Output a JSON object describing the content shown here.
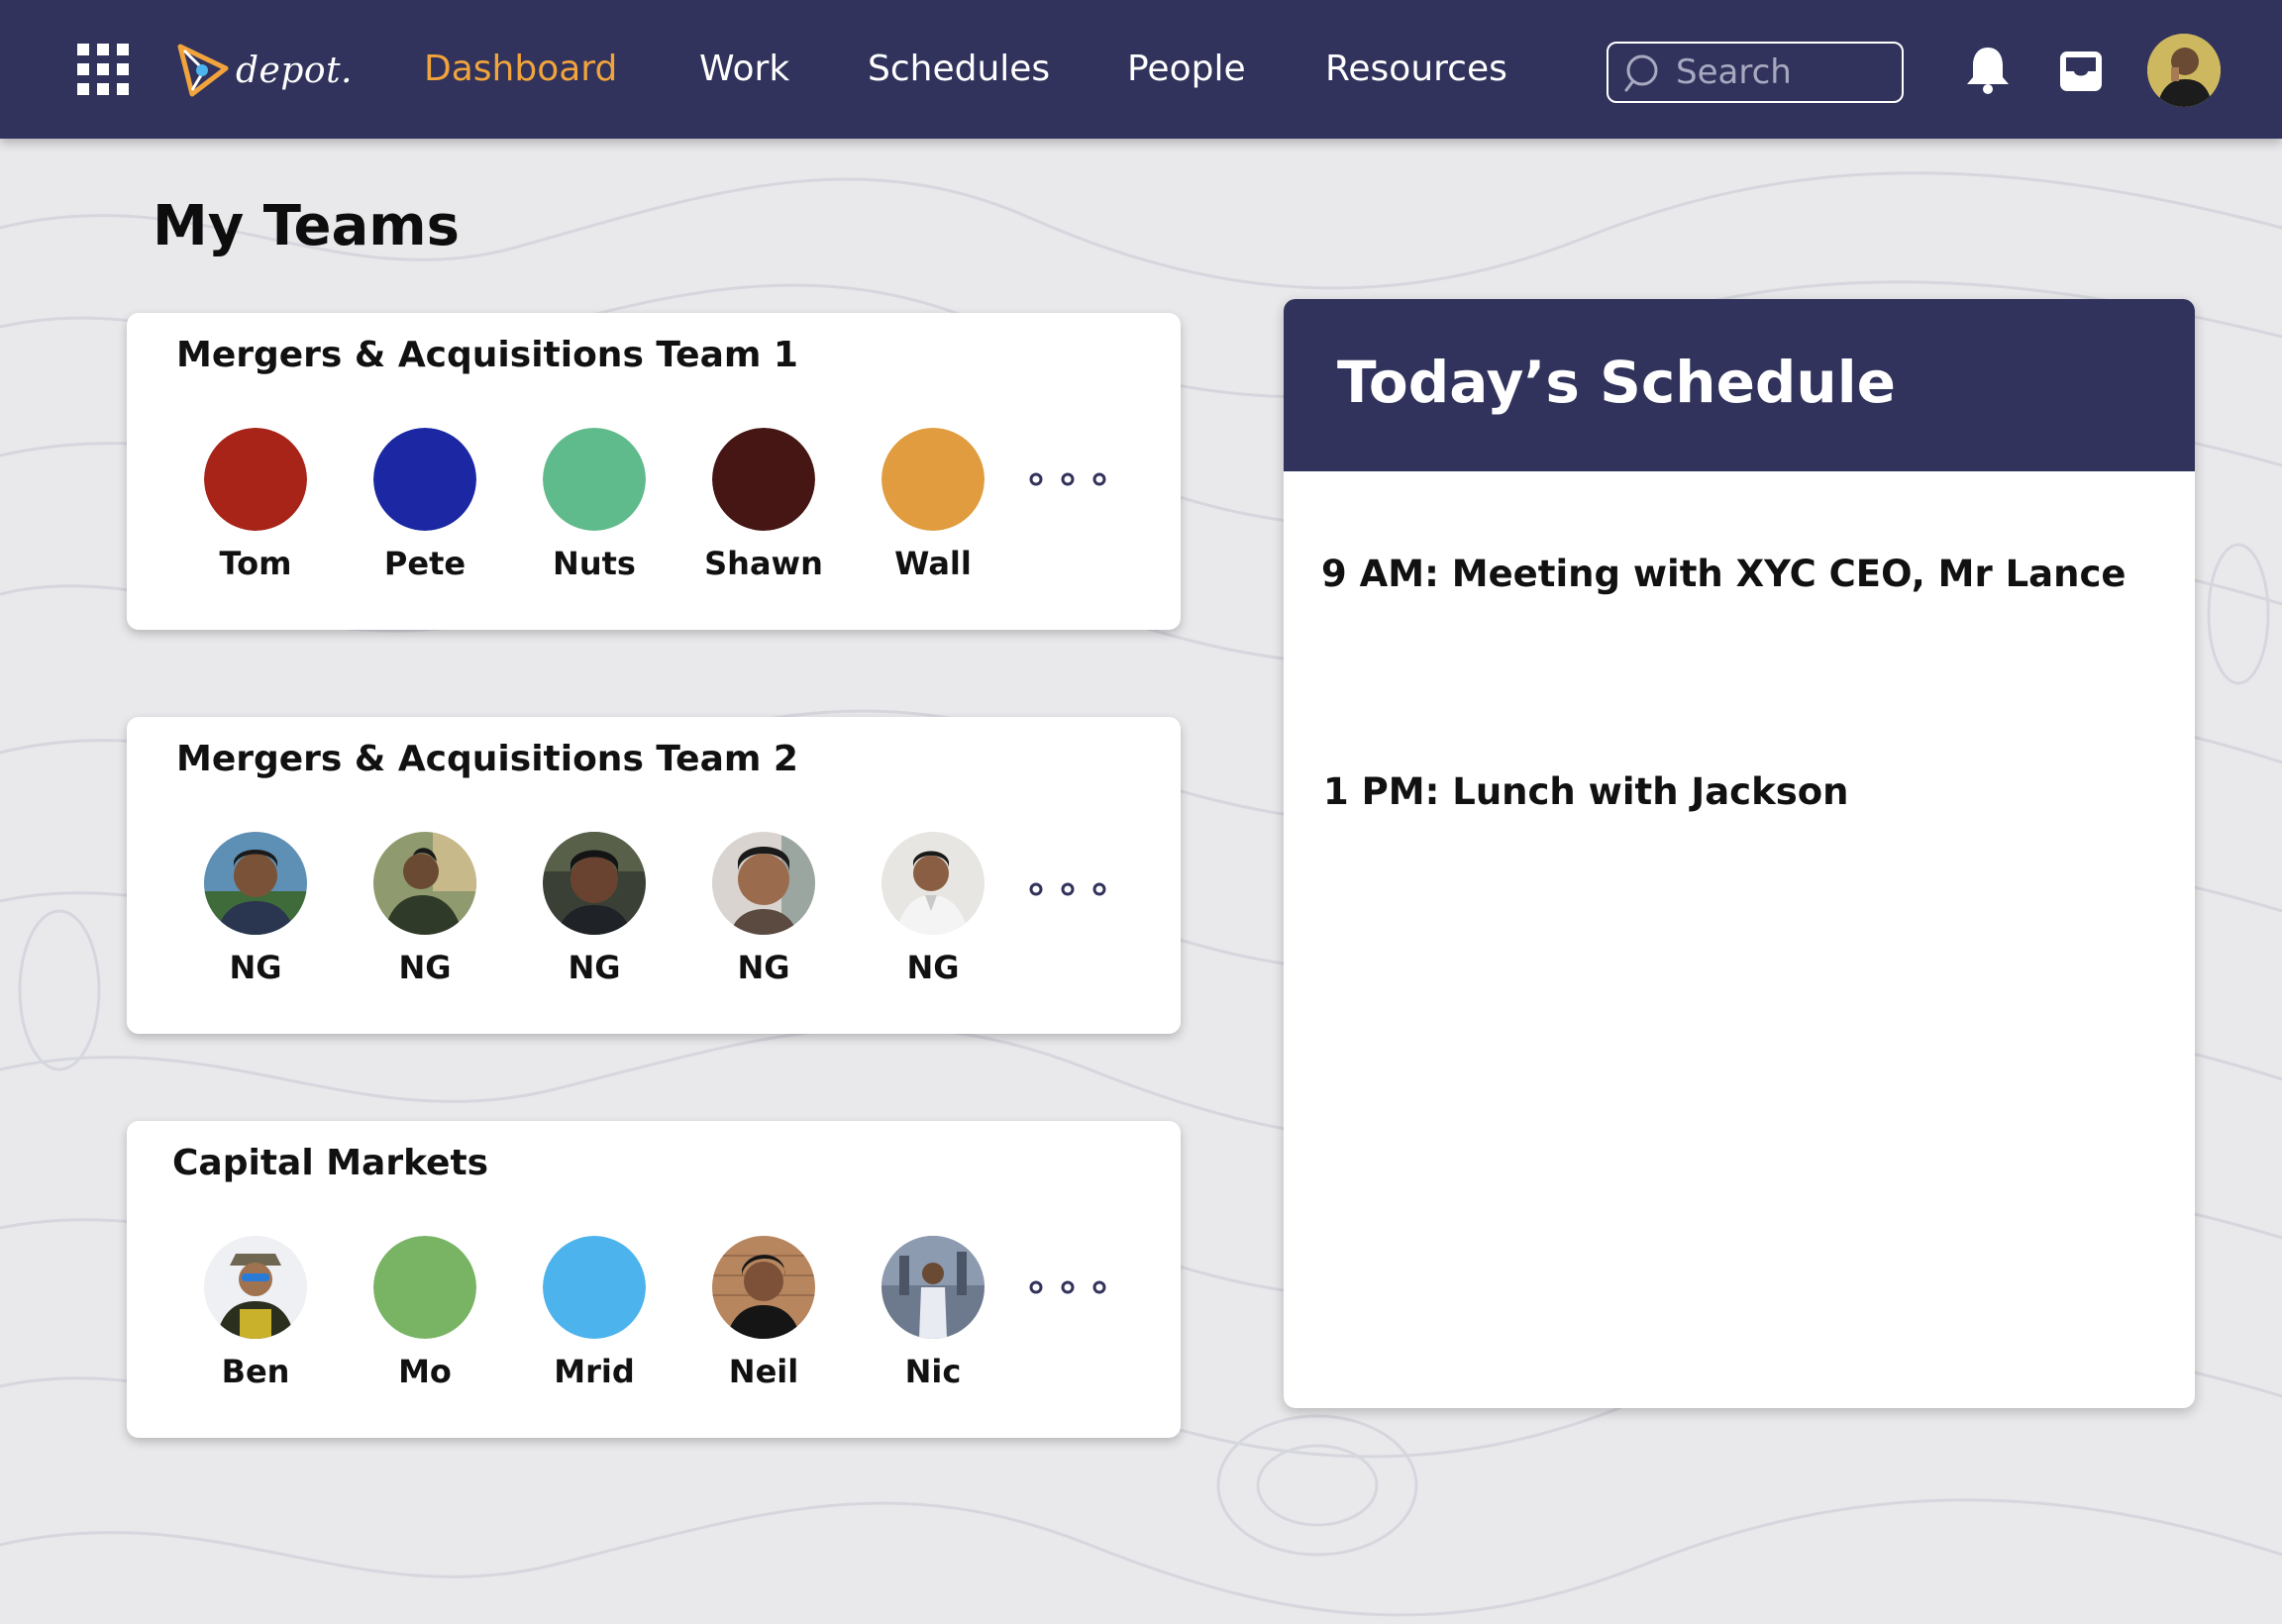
{
  "nav": {
    "logo_text": "depot.",
    "items": [
      {
        "label": "Dashboard",
        "active": true
      },
      {
        "label": "Work",
        "active": false
      },
      {
        "label": "Schedules",
        "active": false
      },
      {
        "label": "People",
        "active": false
      },
      {
        "label": "Resources",
        "active": false
      }
    ],
    "search_placeholder": "Search"
  },
  "colors": {
    "navbar": "#31335c",
    "active_nav": "#f1a33c",
    "background": "#e9e9ec"
  },
  "page_title": "My Teams",
  "teams": [
    {
      "name": "Mergers & Acquisitions Team 1",
      "members": [
        {
          "name": "Tom",
          "avatar_color": "#a82418"
        },
        {
          "name": "Pete",
          "avatar_color": "#1b27a3"
        },
        {
          "name": "Nuts",
          "avatar_color": "#5fbb8b"
        },
        {
          "name": "Shawn",
          "avatar_color": "#461615"
        },
        {
          "name": "Wall",
          "avatar_color": "#e09c3e"
        }
      ]
    },
    {
      "name": "Mergers & Acquisitions Team 2",
      "members": [
        {
          "name": "NG",
          "avatar": "photo"
        },
        {
          "name": "NG",
          "avatar": "photo"
        },
        {
          "name": "NG",
          "avatar": "photo"
        },
        {
          "name": "NG",
          "avatar": "photo"
        },
        {
          "name": "NG",
          "avatar": "photo"
        }
      ]
    },
    {
      "name": "Capital Markets",
      "members": [
        {
          "name": "Ben",
          "avatar": "photo"
        },
        {
          "name": "Mo",
          "avatar_color": "#78b464"
        },
        {
          "name": "Mrid",
          "avatar_color": "#4cb3ec"
        },
        {
          "name": "Neil",
          "avatar": "photo"
        },
        {
          "name": "Nic",
          "avatar": "photo"
        }
      ]
    }
  ],
  "schedule": {
    "title": "Today’s Schedule",
    "items": [
      "9 AM: Meeting with XYC CEO, Mr Lance",
      "1 PM: Lunch with Jackson"
    ]
  }
}
